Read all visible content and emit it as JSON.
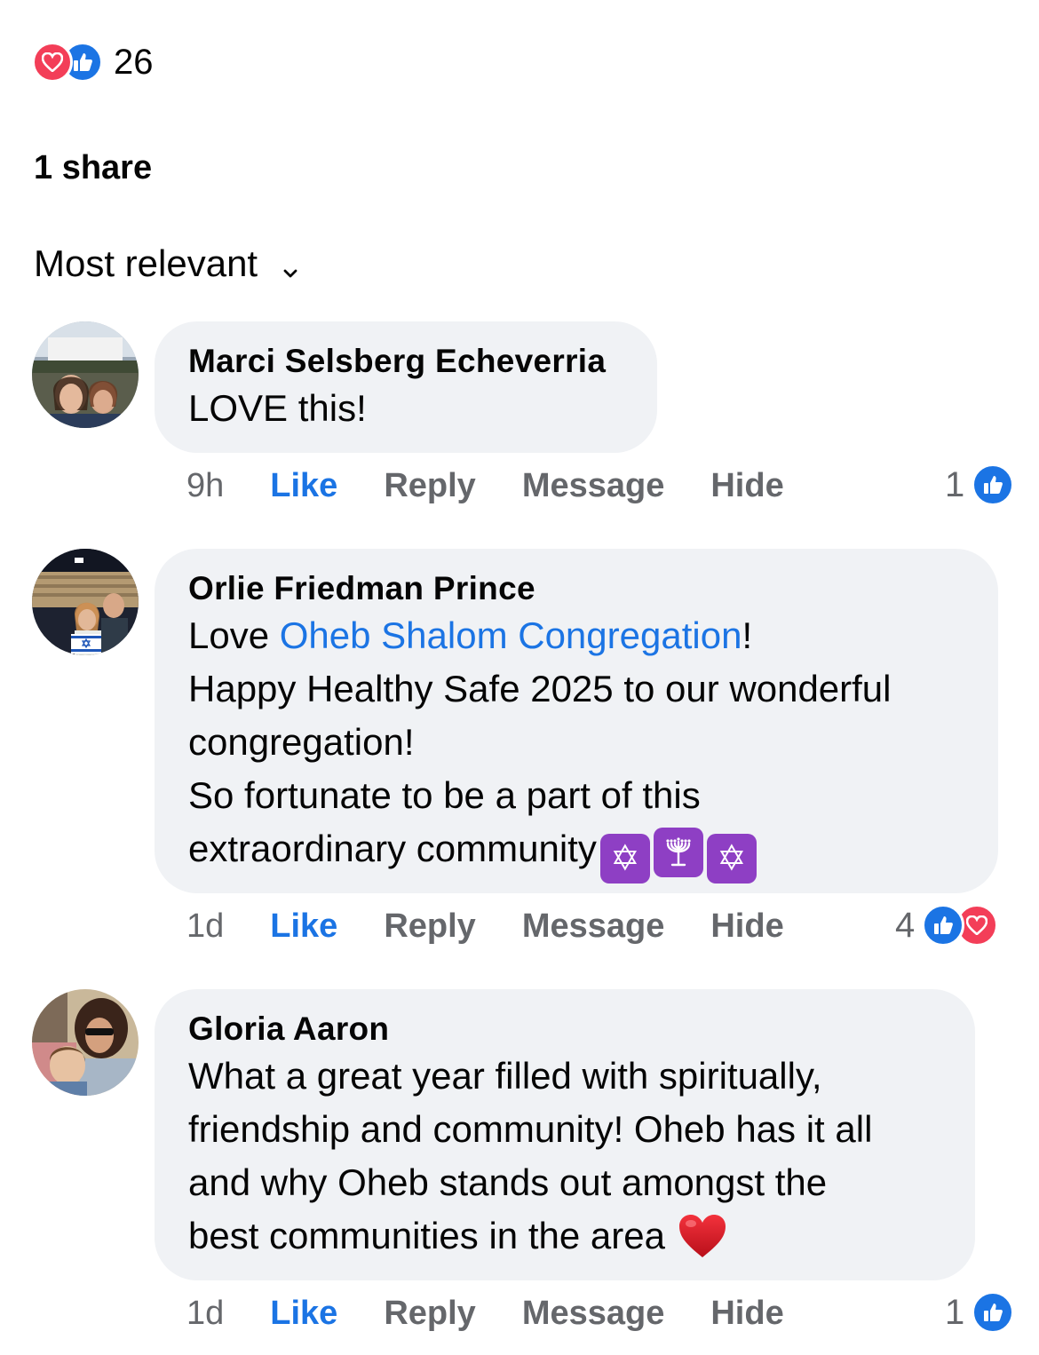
{
  "reactions": {
    "count": "26",
    "icons": [
      "love-icon",
      "like-icon"
    ]
  },
  "shares": "1 share",
  "sort": {
    "label": "Most relevant",
    "icon": "chevron-down-icon"
  },
  "comments": [
    {
      "author": "Marci Selsberg Echeverria",
      "text": "LOVE this!",
      "time": "9h",
      "actions": [
        "Like",
        "Reply",
        "Message",
        "Hide"
      ],
      "reaction_count": "1",
      "reaction_icons": [
        "like-icon"
      ]
    },
    {
      "author": "Orlie Friedman Prince",
      "line1_prefix": "Love ",
      "line1_link": "Oheb Shalom Congregation",
      "line1_suffix": "!",
      "line2": "Happy Healthy Safe 2025 to our wonderful",
      "line3": "congregation!",
      "line4": "So fortunate to be a part of this",
      "line5": "extraordinary community",
      "emojis": [
        "✡",
        "🕎",
        "✡"
      ],
      "time": "1d",
      "actions": [
        "Like",
        "Reply",
        "Message",
        "Hide"
      ],
      "reaction_count": "4",
      "reaction_icons": [
        "like-icon",
        "love-icon"
      ]
    },
    {
      "author": "Gloria Aaron",
      "line1": "What a great year filled with spiritually,",
      "line2": "friendship and community! Oheb has it all",
      "line3": "and why Oheb stands out amongst the",
      "line4": "best communities in the area",
      "emoji": "heart-emoji",
      "time": "1d",
      "actions": [
        "Like",
        "Reply",
        "Message",
        "Hide"
      ],
      "reaction_count": "1",
      "reaction_icons": [
        "like-icon"
      ]
    }
  ],
  "colors": {
    "link": "#1b74e4",
    "like": "#1b74e4",
    "love": "#f33e58",
    "bubble": "#f0f2f5",
    "muted": "#65676b"
  }
}
